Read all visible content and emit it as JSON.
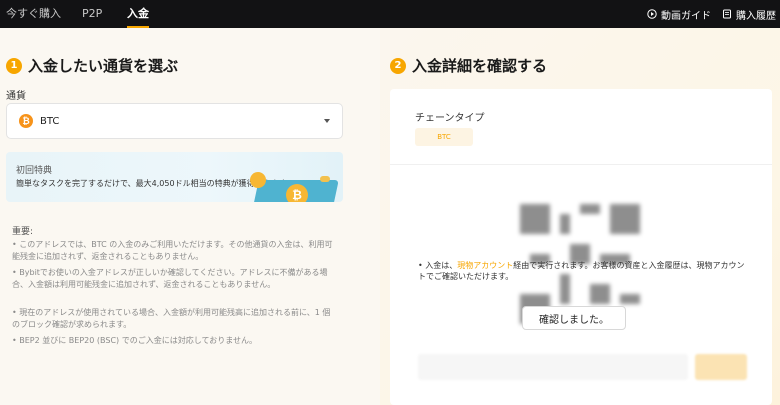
{
  "nav": {
    "tabs": [
      {
        "label": "今すぐ購入"
      },
      {
        "label": "P2P"
      },
      {
        "label": "入金"
      }
    ],
    "video_guide": "動画ガイド",
    "purchase_history": "購入履歴"
  },
  "step1": {
    "number": "1",
    "title": "入金したい通貨を選ぶ",
    "currency_label": "通貨",
    "selected_currency": "BTC",
    "coin_glyph": "₿"
  },
  "promo": {
    "title": "初回特典",
    "text": "簡単なタスクを完了するだけで、最大4,050ドル相当の特典が獲得できます。",
    "coin_glyph": "₿"
  },
  "notes": {
    "title": "重要:",
    "items": [
      "• このアドレスでは、BTC の入金のみご利用いただけます。その他通貨の入金は、利用可能残金に追加されず、返金されることもありません。",
      "• Bybitでお使いの入金アドレスが正しいか確認してください。アドレスに不備がある場合、入金額は利用可能残金に追加されず、返金されることもありません。",
      "• 現在のアドレスが使用されている場合、入金額が利用可能残高に追加される前に、1 個のブロック確認が求められます。",
      "• BEP2 並びに BEP20 (BSC) でのご入金には対応しておりません。"
    ]
  },
  "step2": {
    "number": "2",
    "title": "入金詳細を確認する",
    "chain_label": "チェーンタイプ",
    "chain_value": "BTC",
    "notice_prefix": "• 入金は、",
    "notice_link": "現物アカウント",
    "notice_suffix": "経由で実行されます。お客様の資産と入金履歴は、現物アカウントでご確認いただけます。",
    "confirm_button": "確認しました。"
  },
  "colors": {
    "accent": "#f7a600",
    "topbar": "#121214",
    "btc": "#f7931a"
  }
}
